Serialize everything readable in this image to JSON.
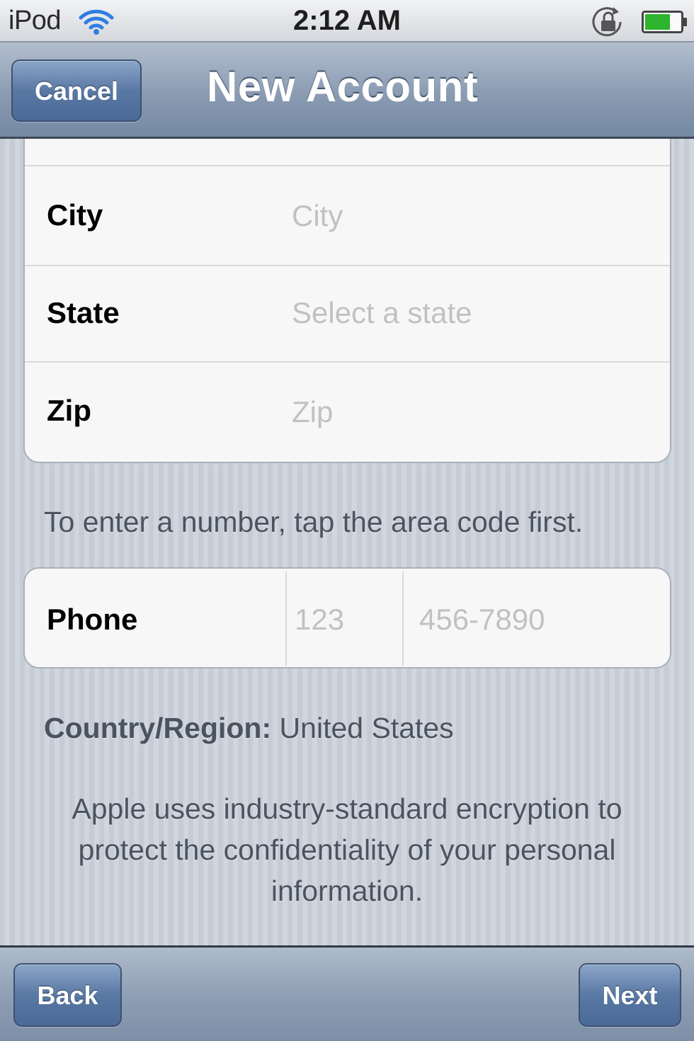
{
  "status_bar": {
    "carrier": "iPod",
    "time": "2:12 AM",
    "wifi_icon": "wifi-icon",
    "lock_icon": "rotation-lock-icon",
    "battery_icon": "battery-icon",
    "battery_level": 0.7,
    "battery_color": "#2db52d"
  },
  "nav": {
    "title": "New Account",
    "cancel_label": "Cancel"
  },
  "address": {
    "rows": [
      {
        "label": "City",
        "placeholder": "City",
        "value": ""
      },
      {
        "label": "State",
        "placeholder": "Select a state"
      },
      {
        "label": "Zip",
        "placeholder": "Zip",
        "value": ""
      }
    ]
  },
  "phone": {
    "hint": "To enter a number, tap the area code first.",
    "label": "Phone",
    "area_code_placeholder": "123",
    "number_placeholder": "456-7890"
  },
  "country": {
    "label": "Country/Region:",
    "value": "United States"
  },
  "privacy": {
    "text": "Apple uses industry-standard encryption to protect the confidentiality of your personal information."
  },
  "toolbar": {
    "back_label": "Back",
    "next_label": "Next"
  },
  "colors": {
    "nav_button": "#5978a4",
    "form_background": "#f7f7f7",
    "placeholder_text": "#bfc1c4",
    "footnote_text": "#4b5360"
  }
}
